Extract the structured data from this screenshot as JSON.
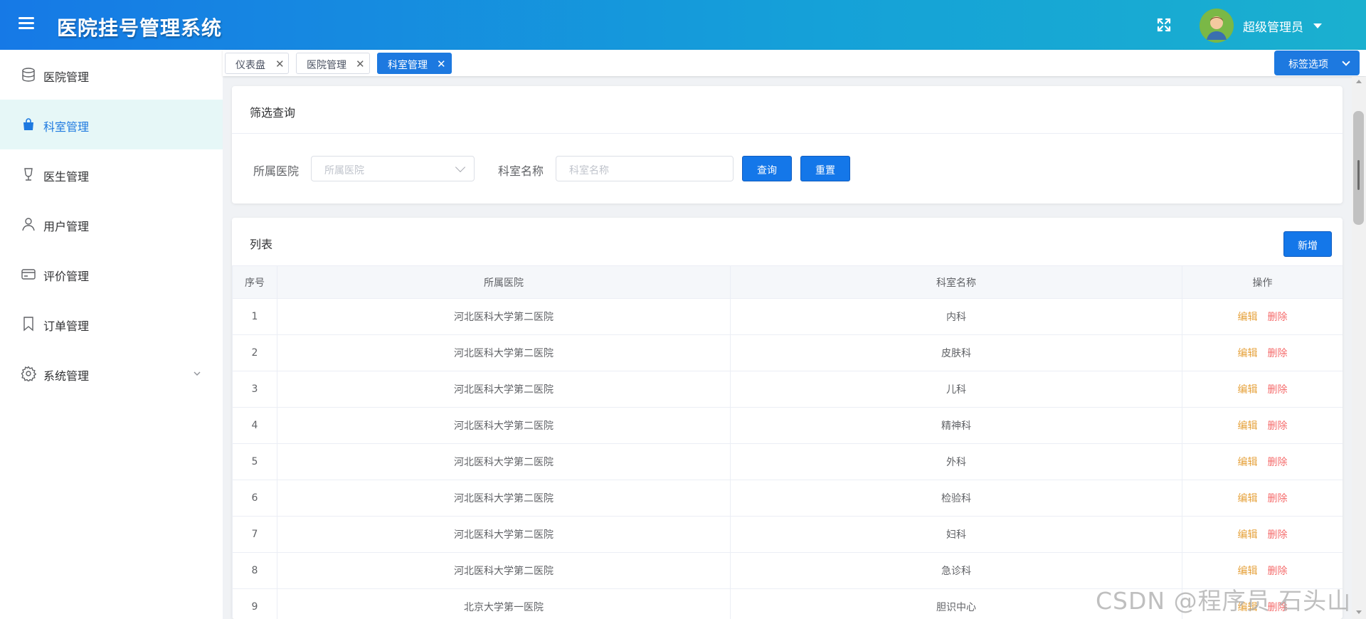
{
  "header": {
    "title": "医院挂号管理系统",
    "user_name": "超级管理员",
    "menu_icon": "hamburger-menu-icon",
    "fullscreen_icon": "fullscreen-icon"
  },
  "sidebar": {
    "items": [
      {
        "label": "医院管理",
        "icon": "database-icon",
        "active": false
      },
      {
        "label": "科室管理",
        "icon": "shopping-bag-icon",
        "active": true
      },
      {
        "label": "医生管理",
        "icon": "goblet-icon",
        "active": false
      },
      {
        "label": "用户管理",
        "icon": "user-icon",
        "active": false
      },
      {
        "label": "评价管理",
        "icon": "credit-card-icon",
        "active": false
      },
      {
        "label": "订单管理",
        "icon": "bookmark-icon",
        "active": false
      },
      {
        "label": "系统管理",
        "icon": "gear-icon",
        "active": false,
        "has_submenu": true
      }
    ]
  },
  "tabs": {
    "items": [
      {
        "label": "仪表盘",
        "active": false
      },
      {
        "label": "医院管理",
        "active": false
      },
      {
        "label": "科室管理",
        "active": true
      }
    ],
    "options_label": "标签选项"
  },
  "filter": {
    "title": "筛选查询",
    "hospital_label": "所属医院",
    "hospital_placeholder": "所属医院",
    "dept_label": "科室名称",
    "dept_placeholder": "科室名称",
    "query_label": "查询",
    "reset_label": "重置"
  },
  "list": {
    "title": "列表",
    "add_label": "新增",
    "columns": [
      "序号",
      "所属医院",
      "科室名称",
      "操作"
    ],
    "edit_label": "编辑",
    "delete_label": "删除",
    "rows": [
      {
        "index": "1",
        "hospital": "河北医科大学第二医院",
        "dept": "内科"
      },
      {
        "index": "2",
        "hospital": "河北医科大学第二医院",
        "dept": "皮肤科"
      },
      {
        "index": "3",
        "hospital": "河北医科大学第二医院",
        "dept": "儿科"
      },
      {
        "index": "4",
        "hospital": "河北医科大学第二医院",
        "dept": "精神科"
      },
      {
        "index": "5",
        "hospital": "河北医科大学第二医院",
        "dept": "外科"
      },
      {
        "index": "6",
        "hospital": "河北医科大学第二医院",
        "dept": "检验科"
      },
      {
        "index": "7",
        "hospital": "河北医科大学第二医院",
        "dept": "妇科"
      },
      {
        "index": "8",
        "hospital": "河北医科大学第二医院",
        "dept": "急诊科"
      },
      {
        "index": "9",
        "hospital": "北京大学第一医院",
        "dept": "胆识中心"
      }
    ]
  },
  "watermark": "CSDN @程序员 石头山",
  "colors": {
    "primary": "#1d79e0",
    "header_start": "#1679e6",
    "header_end": "#1ab0cf",
    "edit": "#e6a23c",
    "delete": "#f56c6c",
    "active_bg": "#e6f7f7"
  }
}
